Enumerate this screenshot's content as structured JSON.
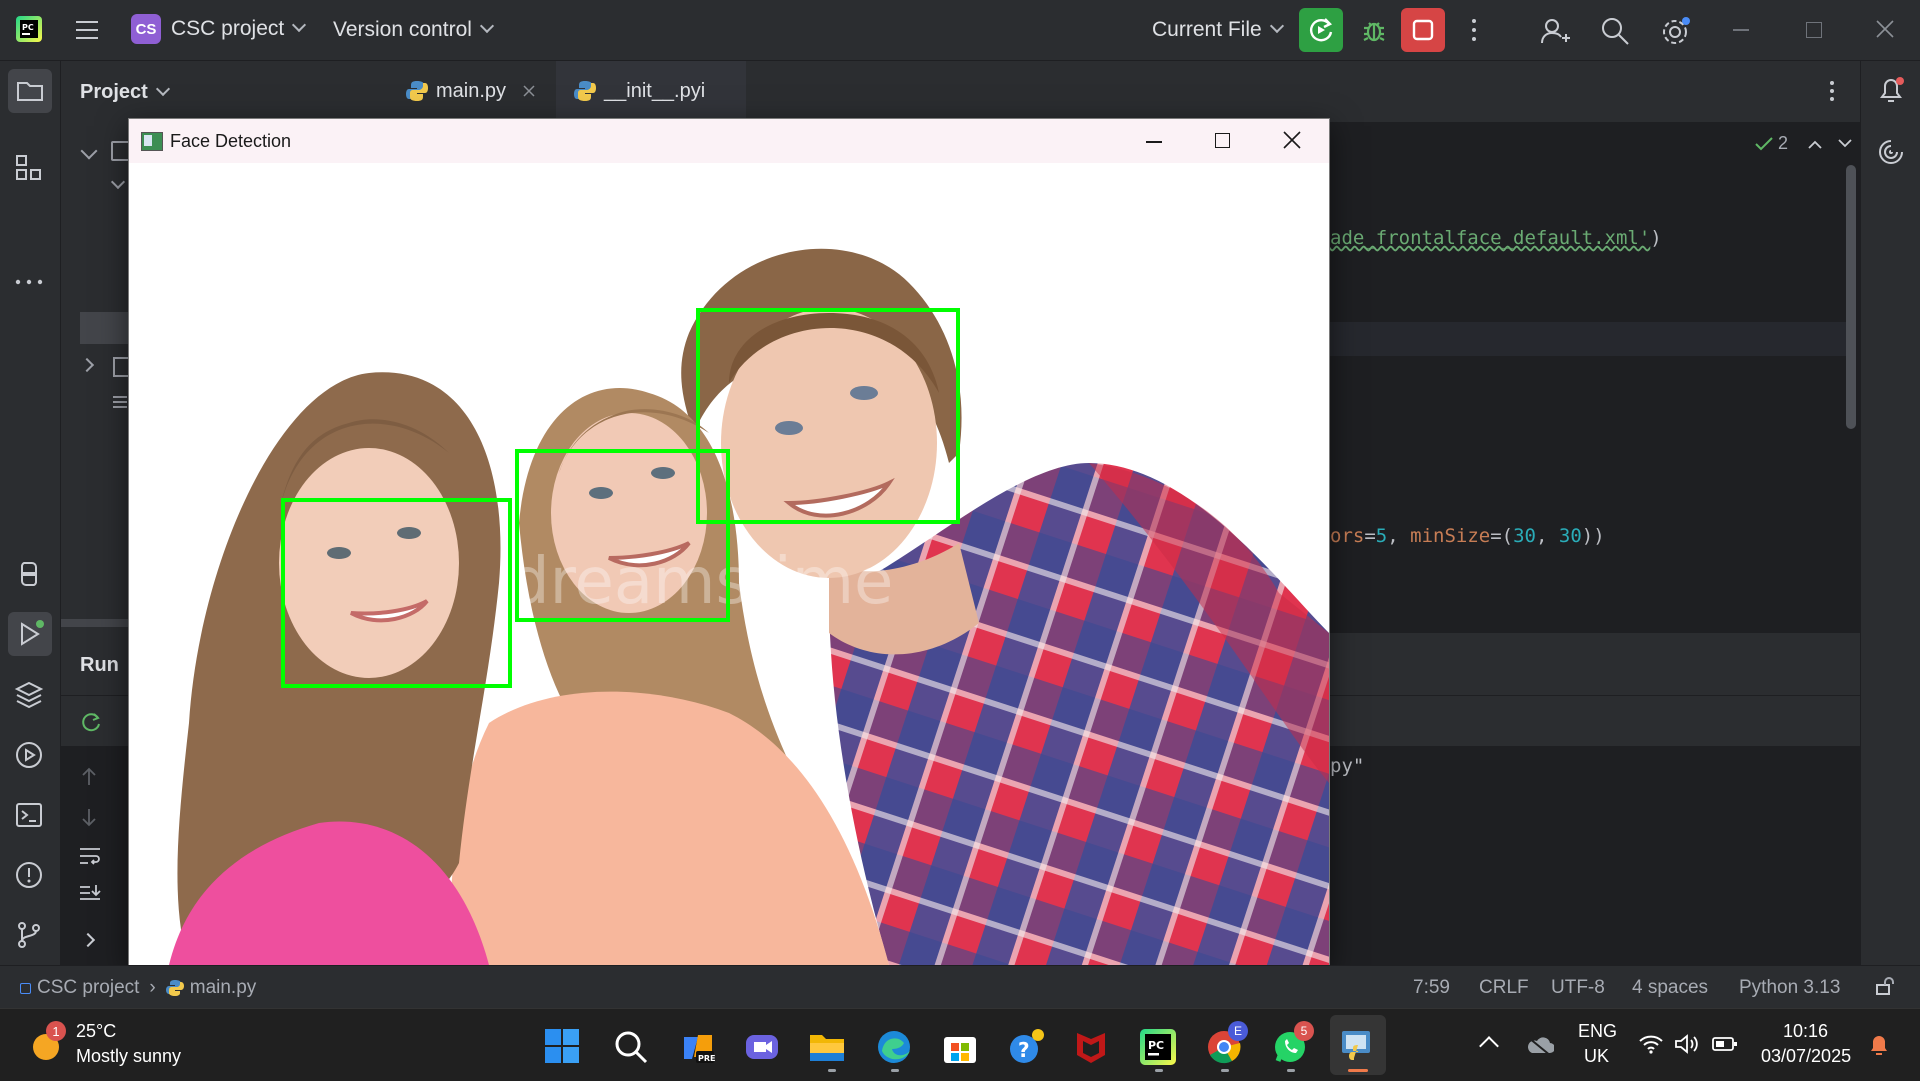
{
  "topbar": {
    "project_badge": "CS",
    "project_name": "CSC project",
    "version_control": "Version control",
    "run_config": "Current File"
  },
  "project_panel": {
    "title": "Project"
  },
  "tabs": [
    {
      "label": "main.py",
      "active": true
    },
    {
      "label": "__init__.pyi",
      "active": false
    }
  ],
  "editor": {
    "inspection_count": "2",
    "line1_string": "ade_frontalface_default.xml'",
    "line1_close": ")",
    "line2_kw1": "ors",
    "line2_eq1": "=",
    "line2_v1": "5",
    "line2_sep": ", ",
    "line2_kw2": "minSize",
    "line2_eq2": "=(",
    "line2_v2": "30",
    "line2_comma": ", ",
    "line2_v3": "30",
    "line2_close": "))"
  },
  "run_panel": {
    "title": "Run",
    "output_fragment": "py\""
  },
  "face_window": {
    "title": "Face Detection",
    "detections": 3
  },
  "statusbar": {
    "project": "CSC project",
    "file": "main.py",
    "position": "7:59",
    "line_sep": "CRLF",
    "encoding": "UTF-8",
    "indent": "4 spaces",
    "interpreter": "Python 3.13"
  },
  "taskbar": {
    "weather_badge": "1",
    "temperature": "25°C",
    "weather": "Mostly sunny",
    "teams_badge": "E",
    "whatsapp_badge": "5",
    "lang1": "ENG",
    "lang2": "UK",
    "time": "10:16",
    "date": "03/07/2025"
  },
  "colors": {
    "accent_green": "#2ea043",
    "stop_red": "#d64545",
    "face_box": "#00ff00",
    "string_green": "#6aab73",
    "param_orange": "#c77d55",
    "number_blue": "#2aacb8"
  }
}
